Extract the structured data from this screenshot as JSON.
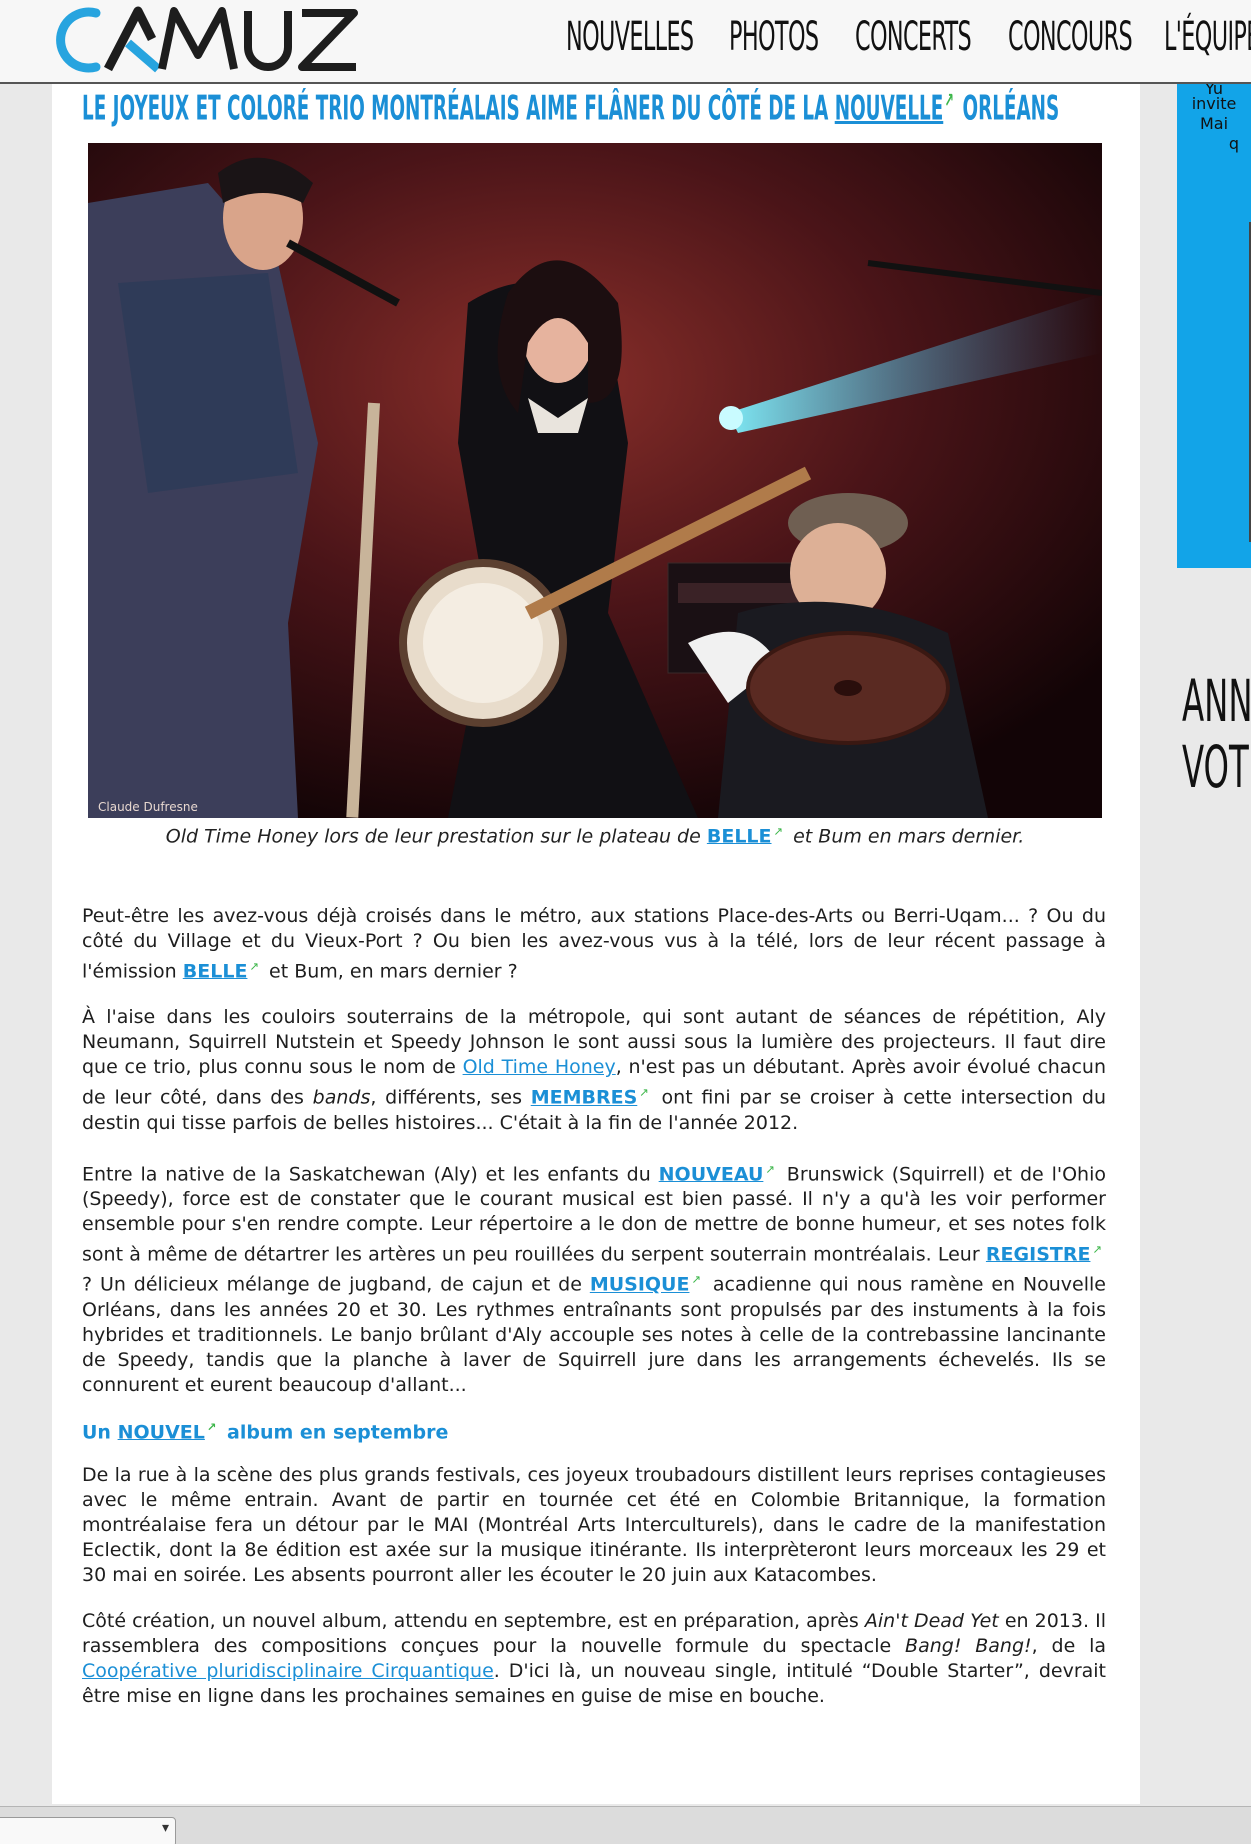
{
  "header": {
    "logo_text": "CAMUZ",
    "nav": [
      "NOUVELLES",
      "PHOTOS",
      "CONCERTS",
      "CONCOURS",
      "L'ÉQUIPE"
    ]
  },
  "article": {
    "headline_before": "LE JOYEUX ET COLORÉ TRIO MONTRÉALAIS AIME FLÂNER DU CÔTÉ DE LA",
    "headline_link": "NOUVELLE",
    "headline_after": "ORLÉANS",
    "photo_credit": "Claude Dufresne",
    "caption_before": "Old Time Honey lors de leur prestation sur le plateau de",
    "caption_link": "BELLE",
    "caption_after": "et Bum en mars dernier.",
    "p1_a": "Peut-être les avez-vous déjà croisés dans le métro, aux stations Place-des-Arts ou Berri-Uqam... ? Ou du côté du Village et du Vieux-Port ?  Ou bien les avez-vous vus à la télé, lors de leur récent passage à l'émission",
    "p1_link": "BELLE",
    "p1_b": "et Bum, en mars dernier ?",
    "p2_a": "À l'aise dans les couloirs souterrains de la métropole, qui sont autant de séances de répétition, Aly Neumann, Squirrell Nutstein et Speedy Johnson le sont aussi sous la lumière des projecteurs. Il faut dire que ce trio, plus connu sous le nom de",
    "p2_name": "Old Time Honey",
    "p2_b": ", n'est pas un débutant. Après avoir évolué chacun de leur côté, dans des",
    "p2_bands": "bands",
    "p2_c": "différents, ses",
    "p2_link": "MEMBRES",
    "p2_d": "ont fini par se croiser à cette intersection du destin qui tisse parfois de belles histoires... C'était à la fin de l'année 2012.",
    "p3_a": "Entre la native de la Saskatchewan (Aly) et les enfants du",
    "p3_link1": "NOUVEAU",
    "p3_b": "Brunswick (Squirrell) et de l'Ohio (Speedy), force est de constater que le courant musical est bien passé. Il n'y a qu'à les voir performer ensemble pour s'en rendre compte. Leur répertoire a le don de mettre de bonne humeur, et ses notes folk sont à même de détartrer les artères un peu rouillées du serpent souterrain montréalais. Leur",
    "p3_link2": "REGISTRE",
    "p3_c": "? Un délicieux mélange de jugband, de cajun et de",
    "p3_link3": "MUSIQUE",
    "p3_d": "acadienne qui nous ramène en Nouvelle Orléans, dans les années 20 et 30. Les rythmes entraînants sont propulsés par des instuments à la fois hybrides et traditionnels. Le banjo brûlant d'Aly accouple ses notes à celle de la contrebassine lancinante de Speedy, tandis que la planche à laver de Squirrell jure dans les arrangements échevelés. Ils se connurent et eurent beaucoup d'allant...",
    "sub_a": "Un",
    "sub_link": "NOUVEL",
    "sub_b": "album en septembre",
    "p4": "De la rue à la scène des plus grands festivals, ces joyeux troubadours distillent leurs reprises contagieuses avec le même entrain. Avant de partir en tournée cet été en Colombie Britannique, la formation montréalaise fera un détour par le MAI (Montréal Arts Interculturels), dans le cadre de la manifestation Eclectik, dont la 8e édition est axée sur la musique itinérante. Ils interprèteront leurs morceaux les 29 et 30 mai en soirée. Les absents pourront aller les écouter le 20 juin aux Katacombes.",
    "p5_a": "Côté création, un nouvel album, attendu en septembre, est en préparation, après",
    "p5_album": "Ain't Dead Yet",
    "p5_b": "en 2013. Il rassemblera des compositions conçues pour la nouvelle formule du spectacle",
    "p5_show": "Bang! Bang!",
    "p5_c": ", de la",
    "p5_coop": "Coopérative pluridisciplinaire Cirquantique",
    "p5_d": ". D'ici là, un nouveau single, intitulé “Double Starter”, devrait être mise en ligne dans les prochaines semaines en guise de mise en bouche."
  },
  "sidebar": {
    "blue_lines": [
      "Yu",
      "invite",
      "Mai",
      "q"
    ],
    "heading_line1": "ANN",
    "heading_line2": "VOT"
  },
  "colors": {
    "accent": "#1b8fd6",
    "external_icon": "#3cb64a",
    "sidebar_blue": "#12a4e8"
  },
  "icons": {
    "external_link": "external-link-icon",
    "dropdown": "chevron-down-icon"
  }
}
